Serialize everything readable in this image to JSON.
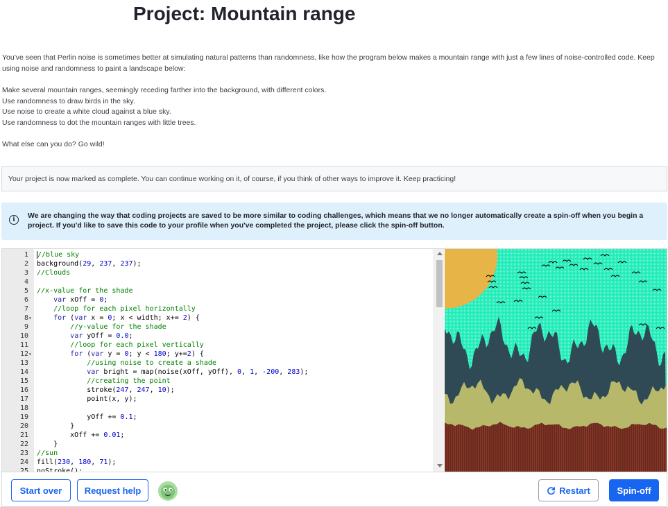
{
  "page": {
    "title": "Project: Mountain range",
    "intro": "You've seen that Perlin noise is sometimes better at simulating natural patterns than randomness, like how the program below makes a mountain range with just a few lines of noise-controlled code. Keep using noise and randomness to paint a landscape below:",
    "tasks": [
      "Make several mountain ranges, seemingly receding farther into the background, with different colors.",
      "Use randomness to draw birds in the sky.",
      "Use noise to create a white cloud against a blue sky.",
      "Use randomness to dot the mountain ranges with little trees."
    ],
    "closing": "What else can you do? Go wild!"
  },
  "complete_message": "Your project is now marked as complete. You can continue working on it, of course, if you think of other ways to improve it. Keep practicing!",
  "notice": {
    "icon": "info-icon",
    "text": "We are changing the way that coding projects are saved to be more similar to coding challenges, which means that we no longer automatically create a spin-off when you begin a project. If you'd like to save this code to your profile when you've completed the project, please click the spin-off button."
  },
  "editor": {
    "lines": [
      {
        "n": "1",
        "fold": "",
        "text": "//blue sky"
      },
      {
        "n": "2",
        "fold": "",
        "text": "background(29, 237, 237);"
      },
      {
        "n": "3",
        "fold": "",
        "text": "//Clouds"
      },
      {
        "n": "4",
        "fold": "",
        "text": ""
      },
      {
        "n": "5",
        "fold": "",
        "text": "//x-value for the shade"
      },
      {
        "n": "6",
        "fold": "",
        "text": "    var xOff = 0;"
      },
      {
        "n": "7",
        "fold": "",
        "text": "    //loop for each pixel horizontally"
      },
      {
        "n": "8",
        "fold": "▾",
        "text": "    for (var x = 0; x < width; x+= 2) {"
      },
      {
        "n": "9",
        "fold": "",
        "text": "        //y-value for the shade"
      },
      {
        "n": "10",
        "fold": "",
        "text": "        var yOff = 0.0;"
      },
      {
        "n": "11",
        "fold": "",
        "text": "        //loop for each pixel vertically"
      },
      {
        "n": "12",
        "fold": "▾",
        "text": "        for (var y = 0; y < 180; y+=2) {"
      },
      {
        "n": "13",
        "fold": "",
        "text": "            //using noise to create a shade"
      },
      {
        "n": "14",
        "fold": "",
        "text": "            var bright = map(noise(xOff, yOff), 0, 1, -200, 283);"
      },
      {
        "n": "15",
        "fold": "",
        "text": "            //creating the point"
      },
      {
        "n": "16",
        "fold": "",
        "text": "            stroke(247, 247, 10);"
      },
      {
        "n": "17",
        "fold": "",
        "text": "            point(x, y);"
      },
      {
        "n": "18",
        "fold": "",
        "text": ""
      },
      {
        "n": "19",
        "fold": "",
        "text": "            yOff += 0.1;"
      },
      {
        "n": "20",
        "fold": "",
        "text": "        }"
      },
      {
        "n": "21",
        "fold": "",
        "text": "        xOff += 0.01;"
      },
      {
        "n": "22",
        "fold": "",
        "text": "    }"
      },
      {
        "n": "23",
        "fold": "",
        "text": "//sun"
      },
      {
        "n": "24",
        "fold": "",
        "text": "fill(230, 180, 71);"
      },
      {
        "n": "25",
        "fold": "",
        "text": "noStroke();"
      }
    ]
  },
  "canvas": {
    "sky_color": "#1dedb8",
    "sun_color": "#e6b447",
    "far_mountain_color": "#2f4a55",
    "mid_mountain_color": "#b7b86a",
    "near_ground_color": "#6b2a1e"
  },
  "footer": {
    "start_over": "Start over",
    "request_help": "Request help",
    "restart": "Restart",
    "spin_off": "Spin-off",
    "avatar_icon": "avatar-icon",
    "restart_icon": "refresh-icon"
  }
}
